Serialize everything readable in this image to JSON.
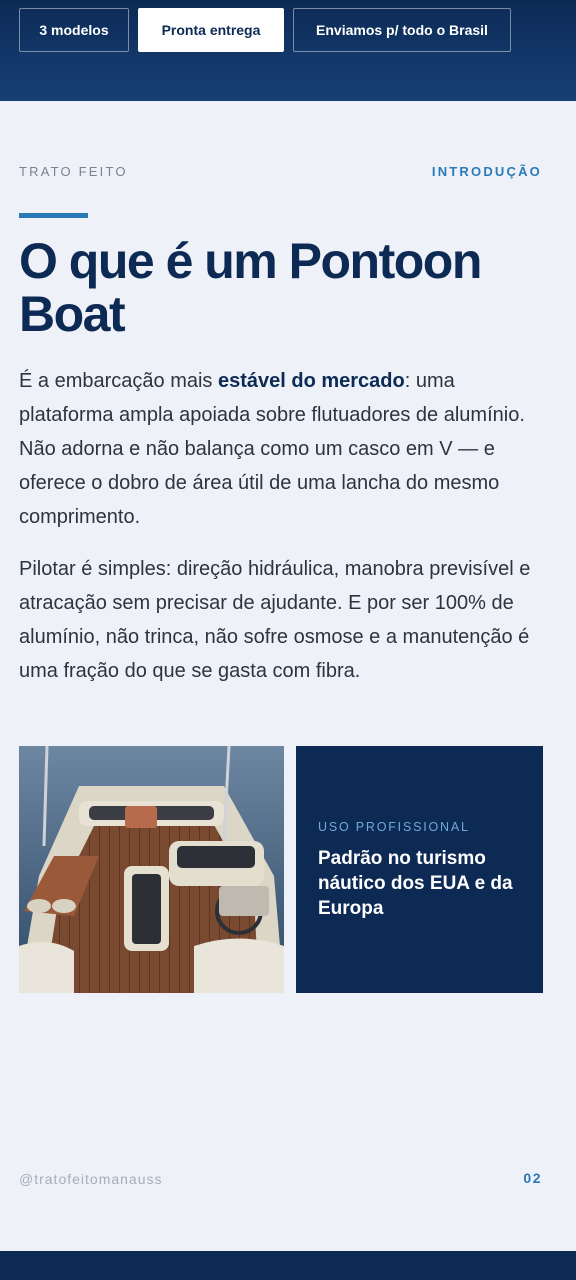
{
  "top_tabs": [
    {
      "label": "3 modelos"
    },
    {
      "label": "Pronta entrega"
    },
    {
      "label": "Enviamos p/ todo o Brasil"
    }
  ],
  "header": {
    "brand": "TRATO FEITO",
    "section": "INTRODUÇÃO"
  },
  "title": "O que é um Pontoon Boat",
  "paragraph1": {
    "before": "É a embarcação mais ",
    "bold": "estável do mercado",
    "after": ": uma plataforma ampla apoiada sobre flutuadores de alumínio. Não adorna e não balança como um casco em V — e oferece o dobro de área útil de uma lancha do mesmo comprimento."
  },
  "paragraph2": "Pilotar é simples: direção hidráulica, manobra previsível e atracação sem precisar de ajudante. E por ser 100% de alumínio, não trinca, não sofre osmose e a manutenção é uma fração do que se gasta com fibra.",
  "card": {
    "label": "USO PROFISSIONAL",
    "title": "Padrão no turismo náutico dos EUA e da Europa"
  },
  "footer": {
    "handle": "@tratofeitomanauss",
    "page": "02"
  },
  "colors": {
    "navy": "#0d2a55",
    "accent": "#2a7ab8",
    "background": "#eef2f8"
  }
}
